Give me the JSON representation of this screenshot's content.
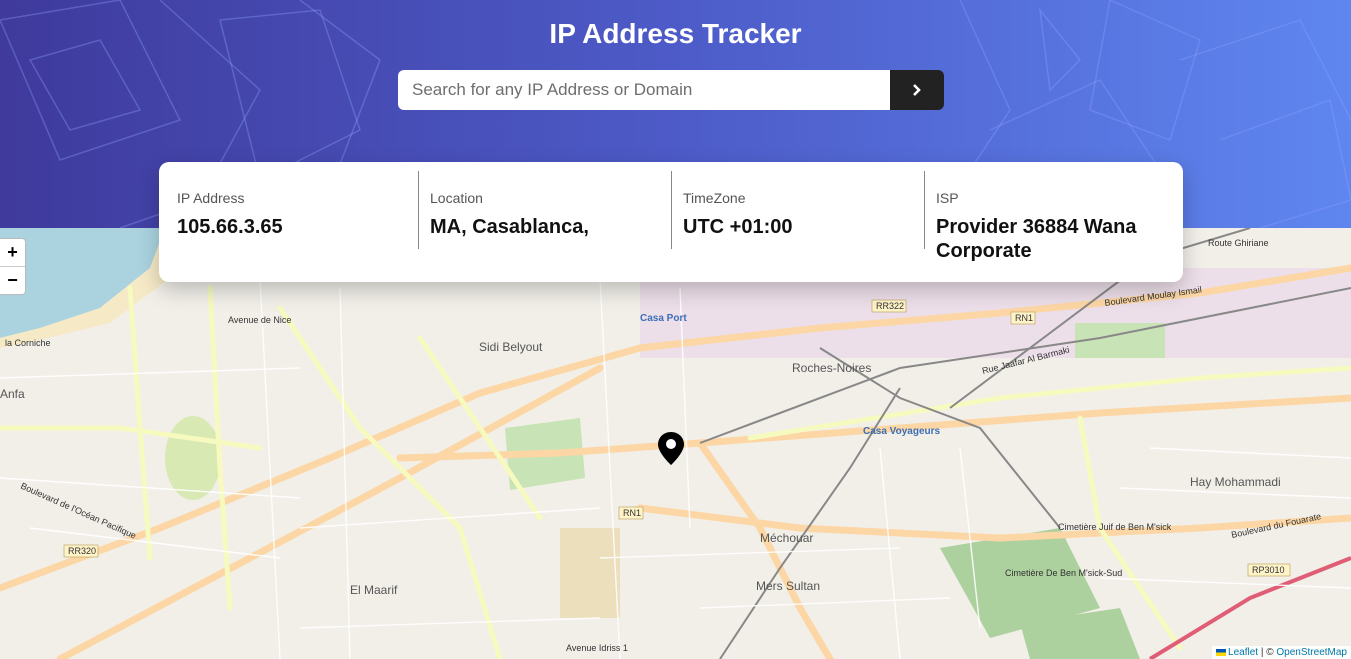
{
  "header": {
    "title": "IP Address Tracker",
    "search_placeholder": "Search for any IP Address or Domain",
    "search_value": "",
    "submit_icon": "chevron-right-icon"
  },
  "info": {
    "ip_label": "IP Address",
    "ip_value": "105.66.3.65",
    "location_label": "Location",
    "location_value": "MA, Casablanca,",
    "timezone_label": "TimeZone",
    "timezone_value": "UTC +01:00",
    "isp_label": "ISP",
    "isp_value": "Provider 36884 Wana Corporate"
  },
  "map": {
    "zoom_in": "+",
    "zoom_out": "−",
    "marker_icon": "location-pin-icon",
    "attribution_leaflet": "Leaflet",
    "attribution_sep": " | © ",
    "attribution_osm": "OpenStreetMap",
    "labels": {
      "sidi_belyout": "Sidi Belyout",
      "roches_noires": "Roches-Noires",
      "hay_mohammadi": "Hay Mohammadi",
      "mechouar": "Méchouar",
      "mers_sultan": "Mers Sultan",
      "el_maarif": "El Maarif",
      "anfa": "Anfa",
      "casa_port": "Casa Port",
      "casa_voyageurs": "Casa Voyageurs",
      "rn1_a": "RN1",
      "rn1_b": "RN1",
      "rr322": "RR322",
      "rr320": "RR320",
      "rp3010": "RP3010",
      "bd_moulay_ismail": "Boulevard Moulay Ismail",
      "bd_fouarate": "Boulevard du Fouarate",
      "bd_ocean": "Boulevard de l'Océan Pacifique",
      "avenue_nice": "Avenue de Nice",
      "la_corniche": "la Corniche",
      "avenue_idriss": "Avenue Idriss 1",
      "cimetiere_juif": "Cimetière Juif de Ben M'sick",
      "cimetiere_ben": "Cimetière De Ben M'sick-Sud",
      "rue_jaafar": "Rue Jaafar Al Barmaki",
      "route_ghiriane": "Route Ghiriane"
    }
  },
  "colors": {
    "header_start": "#3f3a9c",
    "header_end": "#5f86ef",
    "button_bg": "#222222"
  }
}
